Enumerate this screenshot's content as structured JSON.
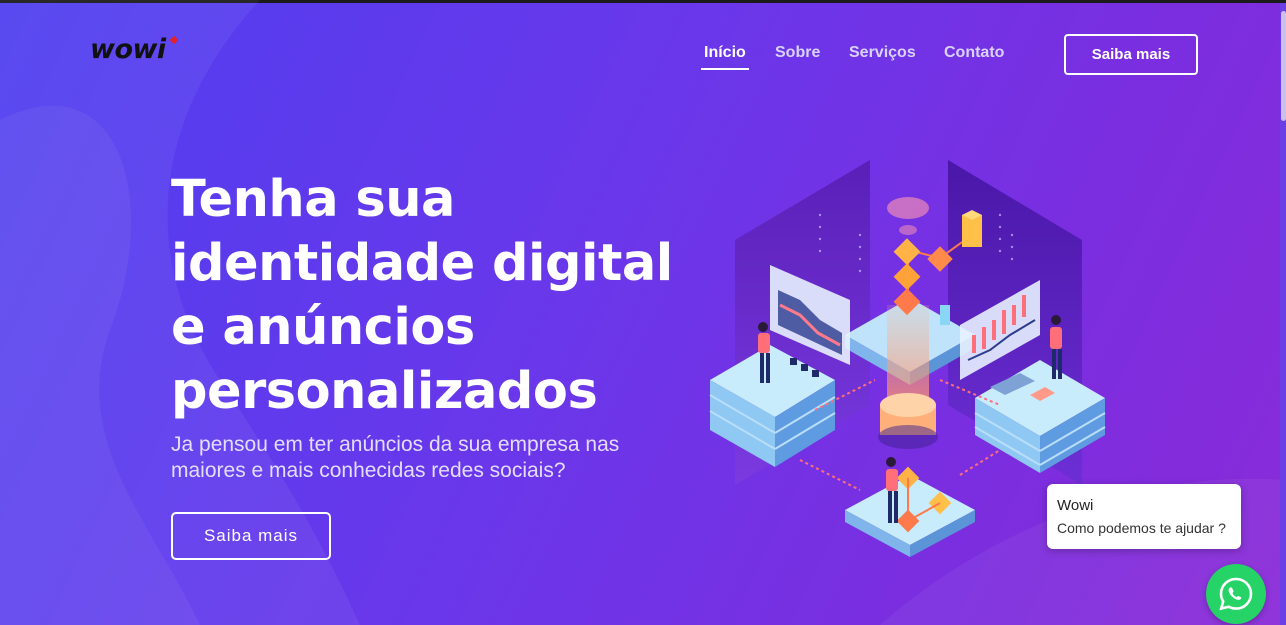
{
  "header": {
    "logo": "wowi",
    "nav": [
      "Início",
      "Sobre",
      "Serviços",
      "Contato"
    ],
    "active_nav": "Início",
    "cta_label": "Saiba mais"
  },
  "hero": {
    "title": "Tenha sua identidade digital e anúncios personalizados",
    "subtitle": "Ja pensou em ter anúncios da sua empresa nas maiores e mais conhecidas redes sociais?",
    "cta_label": "Saiba mais"
  },
  "chat": {
    "name": "Wowi",
    "message": "Como podemos te ajudar ?",
    "button_icon": "whatsapp-icon"
  },
  "colors": {
    "background_start": "#4e3ff0",
    "background_end": "#8a2bd8",
    "whatsapp": "#25d366",
    "logo_accent": "#e4202c"
  }
}
